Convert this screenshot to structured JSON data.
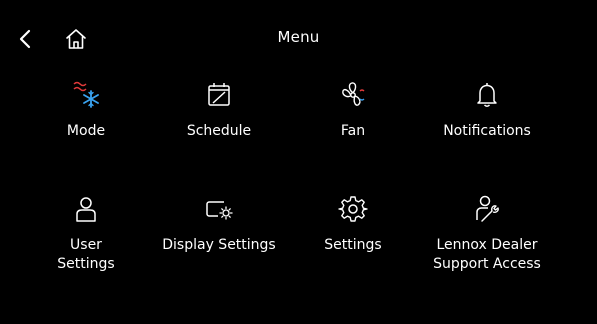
{
  "header": {
    "title": "Menu",
    "back_icon": "chevron-left-icon",
    "home_icon": "home-icon"
  },
  "menu": {
    "items": [
      {
        "label": "Mode",
        "icon": "mode-icon"
      },
      {
        "label": "Schedule",
        "icon": "schedule-icon"
      },
      {
        "label": "Fan",
        "icon": "fan-icon"
      },
      {
        "label": "Notifications",
        "icon": "bell-icon"
      },
      {
        "label": "User\nSettings",
        "icon": "user-icon"
      },
      {
        "label": "Display Settings",
        "icon": "display-settings-icon"
      },
      {
        "label": "Settings",
        "icon": "gear-icon"
      },
      {
        "label": "Lennox Dealer\nSupport Access",
        "icon": "dealer-support-icon"
      }
    ]
  },
  "colors": {
    "background": "#000000",
    "text": "#ffffff",
    "heat": "#e23a3a",
    "cool": "#3aa3f0"
  }
}
